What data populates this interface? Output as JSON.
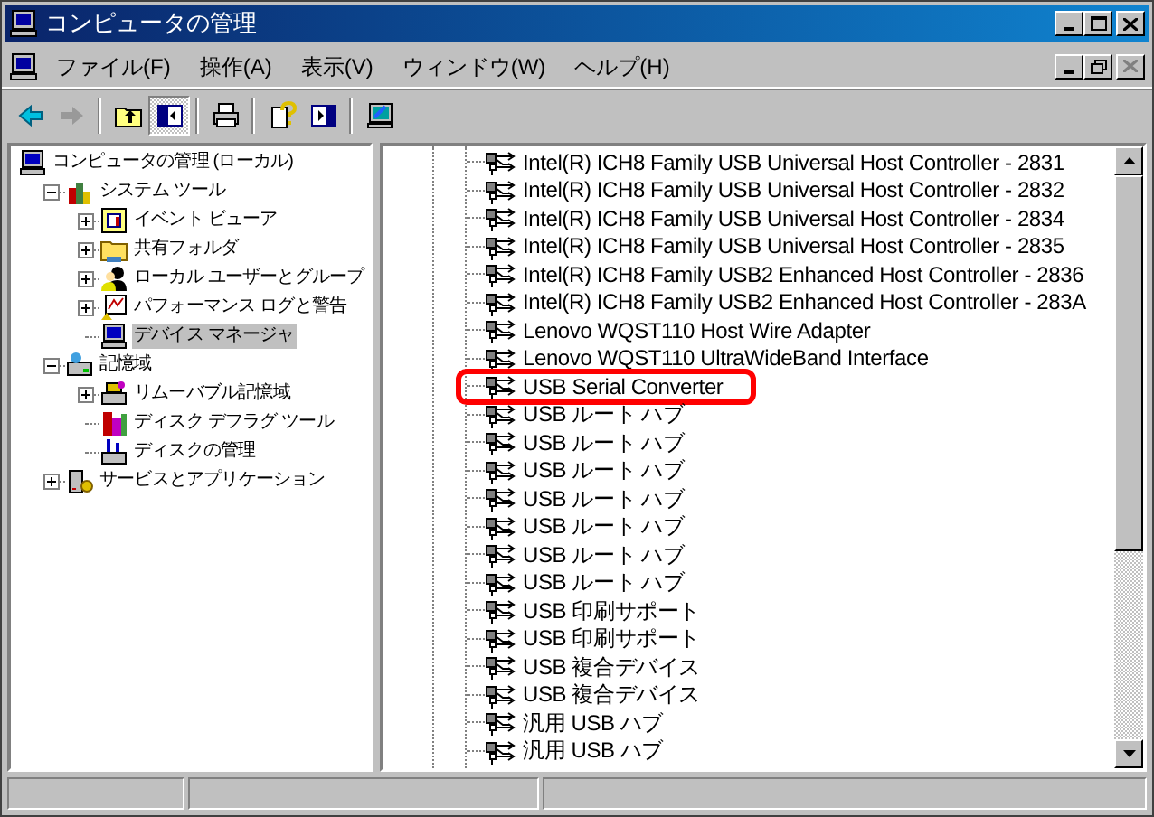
{
  "window": {
    "title": "コンピュータの管理"
  },
  "menu": [
    "ファイル(F)",
    "操作(A)",
    "表示(V)",
    "ウィンドウ(W)",
    "ヘルプ(H)"
  ],
  "toolbar": [
    {
      "kind": "back",
      "disabled": false,
      "pressed": false
    },
    {
      "kind": "forward",
      "disabled": true,
      "pressed": false
    },
    {
      "kind": "up",
      "disabled": false,
      "pressed": false
    },
    {
      "kind": "tree",
      "disabled": false,
      "pressed": true
    },
    {
      "kind": "print",
      "disabled": false,
      "pressed": false
    },
    {
      "kind": "help",
      "disabled": false,
      "pressed": false
    },
    {
      "kind": "pane",
      "disabled": false,
      "pressed": false
    },
    {
      "kind": "props",
      "disabled": false,
      "pressed": false
    }
  ],
  "tree": [
    {
      "label": "コンピュータの管理 (ローカル)",
      "kind": "computer",
      "selected": false,
      "children": [
        {
          "label": "システム ツール",
          "kind": "tools",
          "expanded": true,
          "selected": false,
          "children": [
            {
              "label": "イベント ビューア",
              "kind": "log",
              "expanded": false,
              "selected": false
            },
            {
              "label": "共有フォルダ",
              "kind": "folder",
              "expanded": false,
              "selected": false
            },
            {
              "label": "ローカル ユーザーとグループ",
              "kind": "users",
              "expanded": false,
              "selected": false
            },
            {
              "label": "パフォーマンス ログと警告",
              "kind": "chart",
              "expanded": false,
              "selected": false
            },
            {
              "label": "デバイス マネージャ",
              "kind": "device",
              "selected": true
            }
          ]
        },
        {
          "label": "記憶域",
          "kind": "storage",
          "expanded": true,
          "selected": false,
          "children": [
            {
              "label": "リムーバブル記憶域",
              "kind": "removable",
              "expanded": false,
              "selected": false
            },
            {
              "label": "ディスク デフラグ ツール",
              "kind": "defrag",
              "selected": false
            },
            {
              "label": "ディスクの管理",
              "kind": "disk",
              "selected": false
            }
          ]
        },
        {
          "label": "サービスとアプリケーション",
          "kind": "services",
          "expanded": false,
          "selected": false
        }
      ]
    }
  ],
  "devices": [
    {
      "label": "Intel(R) ICH8 Family USB Universal Host Controller - 2831",
      "highlighted": false
    },
    {
      "label": "Intel(R) ICH8 Family USB Universal Host Controller - 2832",
      "highlighted": false
    },
    {
      "label": "Intel(R) ICH8 Family USB Universal Host Controller - 2834",
      "highlighted": false
    },
    {
      "label": "Intel(R) ICH8 Family USB Universal Host Controller - 2835",
      "highlighted": false
    },
    {
      "label": "Intel(R) ICH8 Family USB2 Enhanced Host Controller - 2836",
      "highlighted": false
    },
    {
      "label": "Intel(R) ICH8 Family USB2 Enhanced Host Controller - 283A",
      "highlighted": false
    },
    {
      "label": "Lenovo WQST110 Host Wire Adapter",
      "highlighted": false
    },
    {
      "label": "Lenovo WQST110 UltraWideBand Interface",
      "highlighted": false
    },
    {
      "label": "USB Serial Converter",
      "highlighted": true
    },
    {
      "label": "USB ルート ハブ",
      "highlighted": false
    },
    {
      "label": "USB ルート ハブ",
      "highlighted": false
    },
    {
      "label": "USB ルート ハブ",
      "highlighted": false
    },
    {
      "label": "USB ルート ハブ",
      "highlighted": false
    },
    {
      "label": "USB ルート ハブ",
      "highlighted": false
    },
    {
      "label": "USB ルート ハブ",
      "highlighted": false
    },
    {
      "label": "USB ルート ハブ",
      "highlighted": false
    },
    {
      "label": "USB 印刷サポート",
      "highlighted": false
    },
    {
      "label": "USB 印刷サポート",
      "highlighted": false
    },
    {
      "label": "USB 複合デバイス",
      "highlighted": false
    },
    {
      "label": "USB 複合デバイス",
      "highlighted": false
    },
    {
      "label": "汎用 USB ハブ",
      "highlighted": false
    },
    {
      "label": "汎用 USB ハブ",
      "highlighted": false
    }
  ]
}
